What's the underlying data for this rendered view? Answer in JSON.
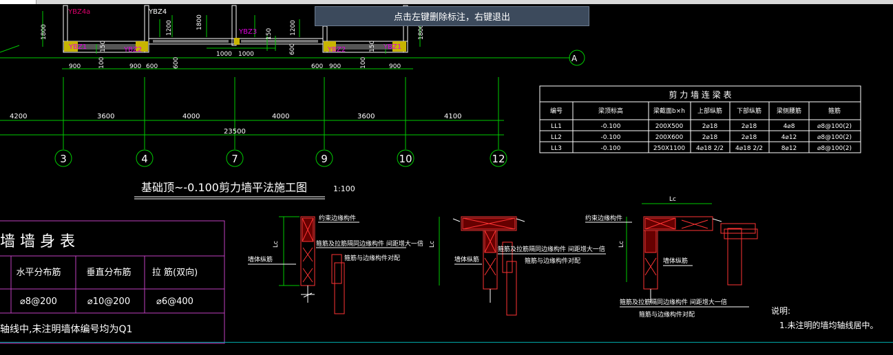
{
  "hint": "点击左键删除标注，右键退出",
  "labels": {
    "ybz4a": "YBZ4a",
    "ybz4": "YBZ4",
    "ybz3": "YBZ3",
    "ybz1": "YBZ1",
    "ybz2": "YBZ2",
    "dim_1800": "1800",
    "dim_1200": "1200",
    "dim_150": "150",
    "dim_900": "900",
    "dim_600": "600",
    "dim_100": "100",
    "dim_1000": "1000",
    "axis_a": "A"
  },
  "spans": [
    "4200",
    "3600",
    "4000",
    "4000",
    "3600",
    "4100"
  ],
  "total_span": "23500",
  "axes": [
    "3",
    "4",
    "7",
    "9",
    "10",
    "12"
  ],
  "drawing_title": "基础顶~-0.100剪力墙平法施工图",
  "scale": "1:100",
  "beam_table": {
    "title": "剪 力 墙 连 梁 表",
    "headers": [
      "编号",
      "梁顶标高",
      "梁截面b×h",
      "上部纵筋",
      "下部纵筋",
      "梁侧腰筋",
      "箍筋"
    ],
    "rows": [
      [
        "LL1",
        "-0.100",
        "200X500",
        "2⌀18",
        "2⌀18",
        "4⌀8",
        "⌀8@100(2)"
      ],
      [
        "LL2",
        "-0.100",
        "200X600",
        "2⌀18",
        "2⌀18",
        "4⌀12",
        "⌀8@100(2)"
      ],
      [
        "LL3",
        "-0.100",
        "250X1100",
        "4⌀18 2/2",
        "4⌀18 2/2",
        "8⌀12",
        "⌀8@100(2)"
      ]
    ]
  },
  "wall_table": {
    "title": "墙 墙 身 表",
    "headers": [
      "水平分布筋",
      "垂直分布筋",
      "拉 筋(双向)"
    ],
    "row": [
      "⌀8@200",
      "⌀10@200",
      "⌀6@400"
    ],
    "note": "轴线中,未注明墙体编号均为Q1"
  },
  "details": {
    "constraint_member": "约束边缘构件",
    "wall_rebar": "墙体纵筋",
    "stirrup_note": "箍筋及拉筋隔同边缘构件 间距增大一倍",
    "bar_note": "箍筋与边缘构件对配",
    "lc": "Lc"
  },
  "notes": {
    "heading": "说明:",
    "item1": "1.未注明的墙均轴线居中。"
  }
}
